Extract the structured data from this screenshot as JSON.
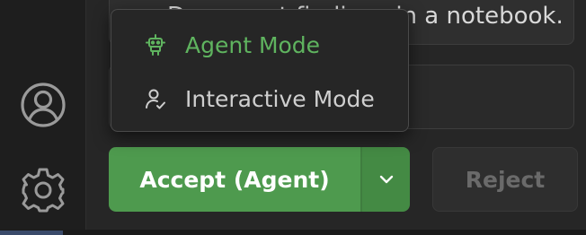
{
  "conversation": {
    "message_text": "Document findings in a notebook."
  },
  "actions": {
    "accept_label": "Accept (Agent)",
    "reject_label": "Reject"
  },
  "mode_menu": {
    "items": [
      {
        "label": "Agent Mode",
        "icon": "robot-icon",
        "selected": true
      },
      {
        "label": "Interactive Mode",
        "icon": "person-check-icon",
        "selected": false
      }
    ]
  },
  "sidebar": {
    "icons": [
      "account-icon",
      "gear-icon"
    ]
  },
  "colors": {
    "accent_green": "#4e9a4e",
    "selected_text": "#5fb45f",
    "background": "#262626"
  }
}
